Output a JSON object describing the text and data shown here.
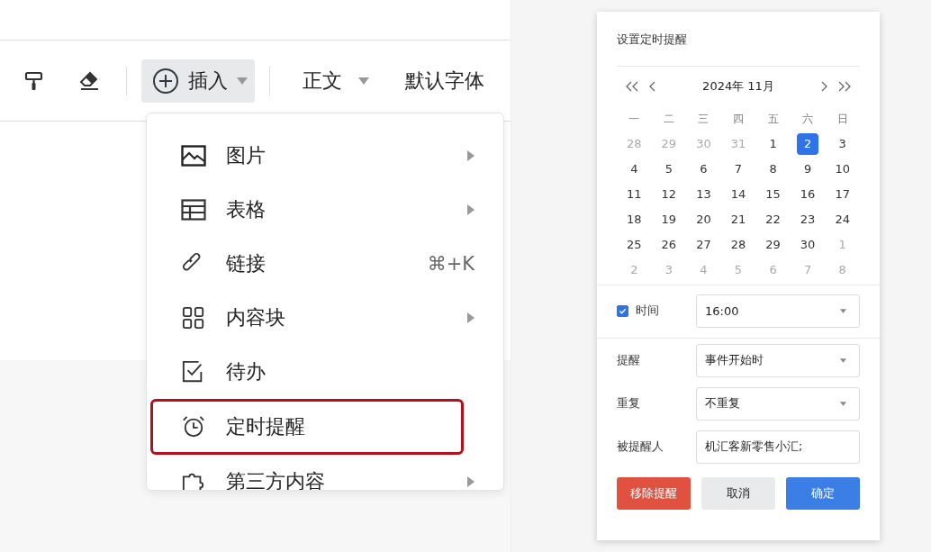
{
  "toolbar": {
    "insert_button": {
      "label": "插入",
      "selected": true
    },
    "style_dropdown": "正文",
    "font_dropdown": "默认字体"
  },
  "insert_menu": [
    {
      "kind": "image",
      "label": "图片",
      "submenu": true,
      "highlighted": false
    },
    {
      "kind": "table",
      "label": "表格",
      "submenu": true,
      "highlighted": false
    },
    {
      "kind": "link",
      "label": "链接",
      "submenu": false,
      "shortcut": "⌘+K",
      "highlighted": false
    },
    {
      "kind": "blocks",
      "label": "内容块",
      "submenu": true,
      "highlighted": false
    },
    {
      "kind": "todo",
      "label": "待办",
      "submenu": false,
      "highlighted": false
    },
    {
      "kind": "alarm",
      "label": "定时提醒",
      "submenu": false,
      "highlighted": true
    },
    {
      "kind": "puzzle",
      "label": "第三方内容",
      "submenu": true,
      "highlighted": false
    }
  ],
  "dialog": {
    "title": "设置定时提醒",
    "calendar": {
      "month_label": "2024年 11月",
      "weekdays": [
        "一",
        "二",
        "三",
        "四",
        "五",
        "六",
        "日"
      ],
      "days": [
        {
          "label": "28",
          "muted": true,
          "selected": false
        },
        {
          "label": "29",
          "muted": true,
          "selected": false
        },
        {
          "label": "30",
          "muted": true,
          "selected": false
        },
        {
          "label": "31",
          "muted": true,
          "selected": false
        },
        {
          "label": "1",
          "muted": false,
          "selected": false
        },
        {
          "label": "2",
          "muted": false,
          "selected": true
        },
        {
          "label": "3",
          "muted": false,
          "selected": false
        },
        {
          "label": "4",
          "muted": false,
          "selected": false
        },
        {
          "label": "5",
          "muted": false,
          "selected": false
        },
        {
          "label": "6",
          "muted": false,
          "selected": false
        },
        {
          "label": "7",
          "muted": false,
          "selected": false
        },
        {
          "label": "8",
          "muted": false,
          "selected": false
        },
        {
          "label": "9",
          "muted": false,
          "selected": false
        },
        {
          "label": "10",
          "muted": false,
          "selected": false
        },
        {
          "label": "11",
          "muted": false,
          "selected": false
        },
        {
          "label": "12",
          "muted": false,
          "selected": false
        },
        {
          "label": "13",
          "muted": false,
          "selected": false
        },
        {
          "label": "14",
          "muted": false,
          "selected": false
        },
        {
          "label": "15",
          "muted": false,
          "selected": false
        },
        {
          "label": "16",
          "muted": false,
          "selected": false
        },
        {
          "label": "17",
          "muted": false,
          "selected": false
        },
        {
          "label": "18",
          "muted": false,
          "selected": false
        },
        {
          "label": "19",
          "muted": false,
          "selected": false
        },
        {
          "label": "20",
          "muted": false,
          "selected": false
        },
        {
          "label": "21",
          "muted": false,
          "selected": false
        },
        {
          "label": "22",
          "muted": false,
          "selected": false
        },
        {
          "label": "23",
          "muted": false,
          "selected": false
        },
        {
          "label": "24",
          "muted": false,
          "selected": false
        },
        {
          "label": "25",
          "muted": false,
          "selected": false
        },
        {
          "label": "26",
          "muted": false,
          "selected": false
        },
        {
          "label": "27",
          "muted": false,
          "selected": false
        },
        {
          "label": "28",
          "muted": false,
          "selected": false
        },
        {
          "label": "29",
          "muted": false,
          "selected": false
        },
        {
          "label": "30",
          "muted": false,
          "selected": false
        },
        {
          "label": "1",
          "muted": true,
          "selected": false
        },
        {
          "label": "2",
          "muted": true,
          "selected": false
        },
        {
          "label": "3",
          "muted": true,
          "selected": false
        },
        {
          "label": "4",
          "muted": true,
          "selected": false
        },
        {
          "label": "5",
          "muted": true,
          "selected": false
        },
        {
          "label": "6",
          "muted": true,
          "selected": false
        },
        {
          "label": "7",
          "muted": true,
          "selected": false
        },
        {
          "label": "8",
          "muted": true,
          "selected": false
        }
      ]
    },
    "time": {
      "label": "时间",
      "checked": true,
      "value": "16:00"
    },
    "fields": [
      {
        "label": "提醒",
        "kind": "select",
        "value": "事件开始时"
      },
      {
        "label": "重复",
        "kind": "select",
        "value": "不重复"
      },
      {
        "label": "被提醒人",
        "kind": "input",
        "value": "机汇客新零售小汇;"
      }
    ],
    "buttons": [
      {
        "label": "移除提醒",
        "kind": "danger"
      },
      {
        "label": "取消",
        "kind": "default"
      },
      {
        "label": "确定",
        "kind": "primary"
      }
    ]
  }
}
